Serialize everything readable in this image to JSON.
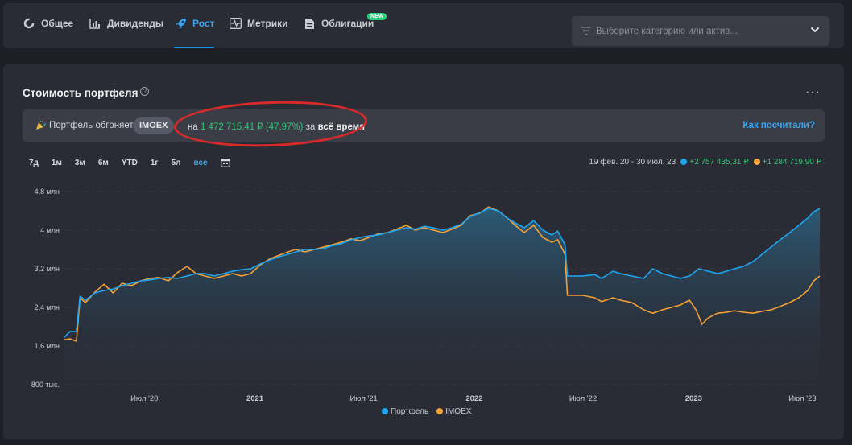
{
  "tabs": [
    {
      "label": "Общее",
      "icon": "donut-icon",
      "active": false
    },
    {
      "label": "Дивиденды",
      "icon": "bar-chart-icon",
      "active": false
    },
    {
      "label": "Рост",
      "icon": "rocket-icon",
      "active": true
    },
    {
      "label": "Метрики",
      "icon": "pulse-icon",
      "active": false
    },
    {
      "label": "Облигации",
      "icon": "document-icon",
      "active": false,
      "badge": "NEW"
    }
  ],
  "category_select": {
    "placeholder": "Выберите категорию или актив..."
  },
  "card": {
    "title": "Стоимость портфеля",
    "help": "?",
    "menu": "···"
  },
  "banner": {
    "prefix": "Портфель обгоняет",
    "benchmark": "IMOEX",
    "on": "на",
    "amount": "1 472 715,41 ₽",
    "percent": "(47,97%)",
    "for": "за",
    "period": "всё время",
    "link": "Как посчитали?"
  },
  "ranges": [
    "7д",
    "1м",
    "3м",
    "6м",
    "YTD",
    "1г",
    "5л",
    "все"
  ],
  "active_range": "все",
  "summary": {
    "period": "19 фев. 20 - 30 июл. 23",
    "portfolio_change": "+2 757 435,31 ₽",
    "imoex_change": "+1 284 719,90 ₽"
  },
  "colors": {
    "portfolio": "#1ea6f2",
    "imoex": "#f4a136",
    "accent": "#3aa5ee",
    "positive": "#2ec873"
  },
  "chart_data": {
    "type": "line",
    "y_ticks": [
      {
        "v": 0.8,
        "label": "800 тыс."
      },
      {
        "v": 1.6,
        "label": "1,6 млн"
      },
      {
        "v": 2.4,
        "label": "2,4 млн"
      },
      {
        "v": 3.2,
        "label": "3,2 млн"
      },
      {
        "v": 4,
        "label": "4 млн"
      },
      {
        "v": 4.8,
        "label": "4,8 млн"
      }
    ],
    "ylim": [
      0.8,
      4.8
    ],
    "x_range": [
      "2020-02-19",
      "2023-07-30"
    ],
    "x_ticks": [
      {
        "date": "2020-07-01",
        "label": "Июл '20",
        "bold": false
      },
      {
        "date": "2021-01-01",
        "label": "2021",
        "bold": true
      },
      {
        "date": "2021-07-01",
        "label": "Июл '21",
        "bold": false
      },
      {
        "date": "2022-01-01",
        "label": "2022",
        "bold": true
      },
      {
        "date": "2022-07-01",
        "label": "Июл '22",
        "bold": false
      },
      {
        "date": "2023-01-01",
        "label": "2023",
        "bold": true
      },
      {
        "date": "2023-07-01",
        "label": "Июл '23",
        "bold": false
      }
    ],
    "series": [
      {
        "name": "Портфель",
        "color": "#1ea6f2",
        "points": [
          [
            "2020-02-19",
            1.78
          ],
          [
            "2020-02-28",
            1.9
          ],
          [
            "2020-03-10",
            1.9
          ],
          [
            "2020-03-16",
            2.63
          ],
          [
            "2020-03-25",
            2.55
          ],
          [
            "2020-04-10",
            2.7
          ],
          [
            "2020-04-25",
            2.75
          ],
          [
            "2020-05-10",
            2.78
          ],
          [
            "2020-05-25",
            2.85
          ],
          [
            "2020-06-10",
            2.9
          ],
          [
            "2020-06-25",
            2.95
          ],
          [
            "2020-07-10",
            2.97
          ],
          [
            "2020-07-25",
            3.0
          ],
          [
            "2020-08-10",
            3.02
          ],
          [
            "2020-08-25",
            3.0
          ],
          [
            "2020-09-10",
            3.05
          ],
          [
            "2020-09-25",
            3.1
          ],
          [
            "2020-10-10",
            3.1
          ],
          [
            "2020-10-25",
            3.05
          ],
          [
            "2020-11-10",
            3.1
          ],
          [
            "2020-11-25",
            3.15
          ],
          [
            "2020-12-10",
            3.18
          ],
          [
            "2020-12-25",
            3.2
          ],
          [
            "2021-01-10",
            3.3
          ],
          [
            "2021-01-25",
            3.38
          ],
          [
            "2021-02-10",
            3.45
          ],
          [
            "2021-02-25",
            3.5
          ],
          [
            "2021-03-10",
            3.55
          ],
          [
            "2021-03-25",
            3.6
          ],
          [
            "2021-04-10",
            3.6
          ],
          [
            "2021-04-25",
            3.62
          ],
          [
            "2021-05-10",
            3.68
          ],
          [
            "2021-05-25",
            3.72
          ],
          [
            "2021-06-10",
            3.8
          ],
          [
            "2021-06-25",
            3.85
          ],
          [
            "2021-07-10",
            3.88
          ],
          [
            "2021-07-25",
            3.9
          ],
          [
            "2021-08-10",
            3.95
          ],
          [
            "2021-08-25",
            4.0
          ],
          [
            "2021-09-10",
            4.05
          ],
          [
            "2021-09-25",
            4.02
          ],
          [
            "2021-10-10",
            4.08
          ],
          [
            "2021-10-25",
            4.05
          ],
          [
            "2021-11-10",
            4.0
          ],
          [
            "2021-11-25",
            4.05
          ],
          [
            "2021-12-10",
            4.12
          ],
          [
            "2021-12-25",
            4.28
          ],
          [
            "2022-01-10",
            4.36
          ],
          [
            "2022-01-25",
            4.45
          ],
          [
            "2022-02-10",
            4.4
          ],
          [
            "2022-02-25",
            4.25
          ],
          [
            "2022-03-10",
            4.15
          ],
          [
            "2022-03-25",
            4.05
          ],
          [
            "2022-04-10",
            4.2
          ],
          [
            "2022-04-25",
            4.0
          ],
          [
            "2022-05-10",
            3.9
          ],
          [
            "2022-05-20",
            3.98
          ],
          [
            "2022-06-01",
            3.7
          ],
          [
            "2022-06-05",
            3.05
          ],
          [
            "2022-07-01",
            3.05
          ],
          [
            "2022-07-20",
            3.08
          ],
          [
            "2022-08-01",
            3.0
          ],
          [
            "2022-08-20",
            3.15
          ],
          [
            "2022-09-01",
            3.1
          ],
          [
            "2022-09-20",
            3.05
          ],
          [
            "2022-10-10",
            3.0
          ],
          [
            "2022-10-25",
            3.2
          ],
          [
            "2022-11-10",
            3.1
          ],
          [
            "2022-11-25",
            3.05
          ],
          [
            "2022-12-10",
            3.0
          ],
          [
            "2022-12-25",
            3.05
          ],
          [
            "2023-01-10",
            3.2
          ],
          [
            "2023-01-25",
            3.15
          ],
          [
            "2023-02-10",
            3.1
          ],
          [
            "2023-02-25",
            3.15
          ],
          [
            "2023-03-10",
            3.2
          ],
          [
            "2023-03-25",
            3.25
          ],
          [
            "2023-04-10",
            3.35
          ],
          [
            "2023-04-25",
            3.5
          ],
          [
            "2023-05-10",
            3.65
          ],
          [
            "2023-05-25",
            3.8
          ],
          [
            "2023-06-10",
            3.95
          ],
          [
            "2023-06-25",
            4.1
          ],
          [
            "2023-07-10",
            4.25
          ],
          [
            "2023-07-20",
            4.38
          ],
          [
            "2023-07-30",
            4.45
          ]
        ]
      },
      {
        "name": "IMOEX",
        "color": "#f4a136",
        "points": [
          [
            "2020-02-19",
            1.73
          ],
          [
            "2020-02-28",
            1.75
          ],
          [
            "2020-03-10",
            1.7
          ],
          [
            "2020-03-16",
            2.6
          ],
          [
            "2020-03-25",
            2.5
          ],
          [
            "2020-04-10",
            2.72
          ],
          [
            "2020-04-25",
            2.88
          ],
          [
            "2020-05-10",
            2.7
          ],
          [
            "2020-05-25",
            2.9
          ],
          [
            "2020-06-10",
            2.85
          ],
          [
            "2020-06-25",
            2.95
          ],
          [
            "2020-07-10",
            3.0
          ],
          [
            "2020-07-25",
            3.02
          ],
          [
            "2020-08-10",
            2.95
          ],
          [
            "2020-08-25",
            3.12
          ],
          [
            "2020-09-10",
            3.25
          ],
          [
            "2020-09-25",
            3.1
          ],
          [
            "2020-10-10",
            3.05
          ],
          [
            "2020-10-25",
            3.0
          ],
          [
            "2020-11-10",
            3.05
          ],
          [
            "2020-11-25",
            3.1
          ],
          [
            "2020-12-10",
            3.05
          ],
          [
            "2020-12-25",
            3.1
          ],
          [
            "2021-01-10",
            3.28
          ],
          [
            "2021-01-25",
            3.4
          ],
          [
            "2021-02-10",
            3.48
          ],
          [
            "2021-02-25",
            3.55
          ],
          [
            "2021-03-10",
            3.6
          ],
          [
            "2021-03-25",
            3.55
          ],
          [
            "2021-04-10",
            3.6
          ],
          [
            "2021-04-25",
            3.65
          ],
          [
            "2021-05-10",
            3.7
          ],
          [
            "2021-05-25",
            3.75
          ],
          [
            "2021-06-10",
            3.82
          ],
          [
            "2021-06-25",
            3.78
          ],
          [
            "2021-07-10",
            3.85
          ],
          [
            "2021-07-25",
            3.92
          ],
          [
            "2021-08-10",
            3.95
          ],
          [
            "2021-08-25",
            4.02
          ],
          [
            "2021-09-10",
            4.1
          ],
          [
            "2021-09-25",
            4.0
          ],
          [
            "2021-10-10",
            4.05
          ],
          [
            "2021-10-25",
            4.0
          ],
          [
            "2021-11-10",
            3.95
          ],
          [
            "2021-11-25",
            4.02
          ],
          [
            "2021-12-10",
            4.1
          ],
          [
            "2021-12-25",
            4.3
          ],
          [
            "2022-01-10",
            4.35
          ],
          [
            "2022-01-25",
            4.48
          ],
          [
            "2022-02-10",
            4.4
          ],
          [
            "2022-02-25",
            4.25
          ],
          [
            "2022-03-10",
            4.1
          ],
          [
            "2022-03-25",
            3.95
          ],
          [
            "2022-04-10",
            4.1
          ],
          [
            "2022-04-25",
            3.85
          ],
          [
            "2022-05-10",
            3.75
          ],
          [
            "2022-05-20",
            3.8
          ],
          [
            "2022-06-01",
            3.5
          ],
          [
            "2022-06-05",
            2.65
          ],
          [
            "2022-07-01",
            2.65
          ],
          [
            "2022-07-20",
            2.6
          ],
          [
            "2022-08-01",
            2.52
          ],
          [
            "2022-08-20",
            2.6
          ],
          [
            "2022-09-01",
            2.55
          ],
          [
            "2022-09-20",
            2.5
          ],
          [
            "2022-10-10",
            2.35
          ],
          [
            "2022-10-25",
            2.28
          ],
          [
            "2022-11-10",
            2.35
          ],
          [
            "2022-11-25",
            2.4
          ],
          [
            "2022-12-10",
            2.45
          ],
          [
            "2022-12-25",
            2.55
          ],
          [
            "2023-01-05",
            2.35
          ],
          [
            "2023-01-15",
            2.05
          ],
          [
            "2023-01-25",
            2.18
          ],
          [
            "2023-02-10",
            2.28
          ],
          [
            "2023-02-25",
            2.3
          ],
          [
            "2023-03-10",
            2.33
          ],
          [
            "2023-03-25",
            2.3
          ],
          [
            "2023-04-10",
            2.28
          ],
          [
            "2023-04-25",
            2.32
          ],
          [
            "2023-05-10",
            2.35
          ],
          [
            "2023-05-25",
            2.42
          ],
          [
            "2023-06-10",
            2.5
          ],
          [
            "2023-06-25",
            2.6
          ],
          [
            "2023-07-10",
            2.75
          ],
          [
            "2023-07-20",
            2.95
          ],
          [
            "2023-07-30",
            3.05
          ]
        ]
      }
    ],
    "legend": "bottom",
    "grid": true
  }
}
